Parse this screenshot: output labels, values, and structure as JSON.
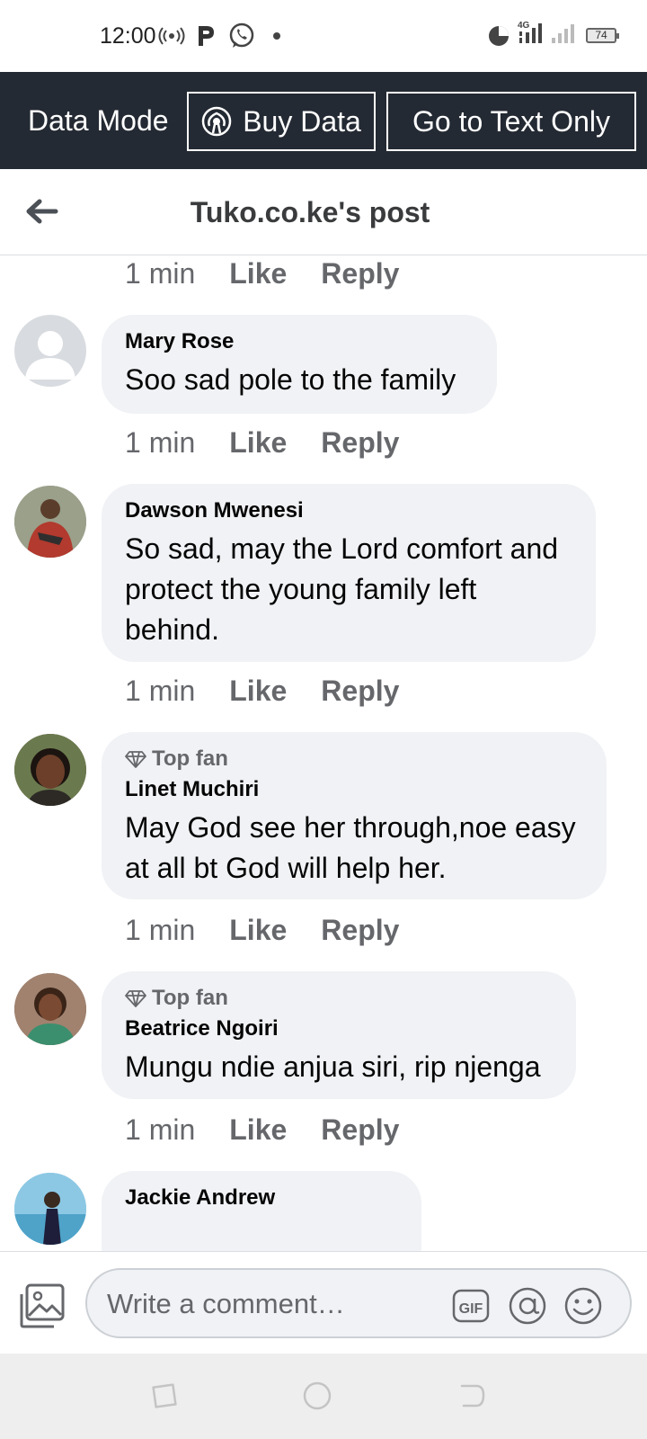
{
  "status_bar": {
    "time": "12:00",
    "battery": "74",
    "network": "4G"
  },
  "data_mode": {
    "label": "Data Mode",
    "buy_data": "Buy Data",
    "text_only": "Go to Text Only"
  },
  "header": {
    "title": "Tuko.co.ke's post"
  },
  "top_meta": {
    "time": "1 min",
    "like": "Like",
    "reply": "Reply"
  },
  "comments": [
    {
      "name": "Mary Rose",
      "top_fan": "",
      "text": "Soo sad pole to the family",
      "time": "1 min",
      "like": "Like",
      "reply": "Reply"
    },
    {
      "name": "Dawson Mwenesi",
      "top_fan": "",
      "text": "So sad, may the Lord comfort and protect the young family left behind.",
      "time": "1 min",
      "like": "Like",
      "reply": "Reply"
    },
    {
      "name": "Linet Muchiri",
      "top_fan": "Top fan",
      "text": "May God see her through,noe easy at all bt God will help her.",
      "time": "1 min",
      "like": "Like",
      "reply": "Reply"
    },
    {
      "name": "Beatrice Ngoiri",
      "top_fan": "Top fan",
      "text": "Mungu ndie anjua siri, rip njenga",
      "time": "1 min",
      "like": "Like",
      "reply": "Reply"
    },
    {
      "name": "Jackie Andrew",
      "top_fan": "",
      "text": "",
      "time": "",
      "like": "",
      "reply": ""
    }
  ],
  "composer": {
    "placeholder": "Write a comment…",
    "gif_label": "GIF"
  },
  "colors": {
    "data_bar": "#242a33",
    "bubble": "#f0f2f5",
    "meta": "#65676b"
  }
}
